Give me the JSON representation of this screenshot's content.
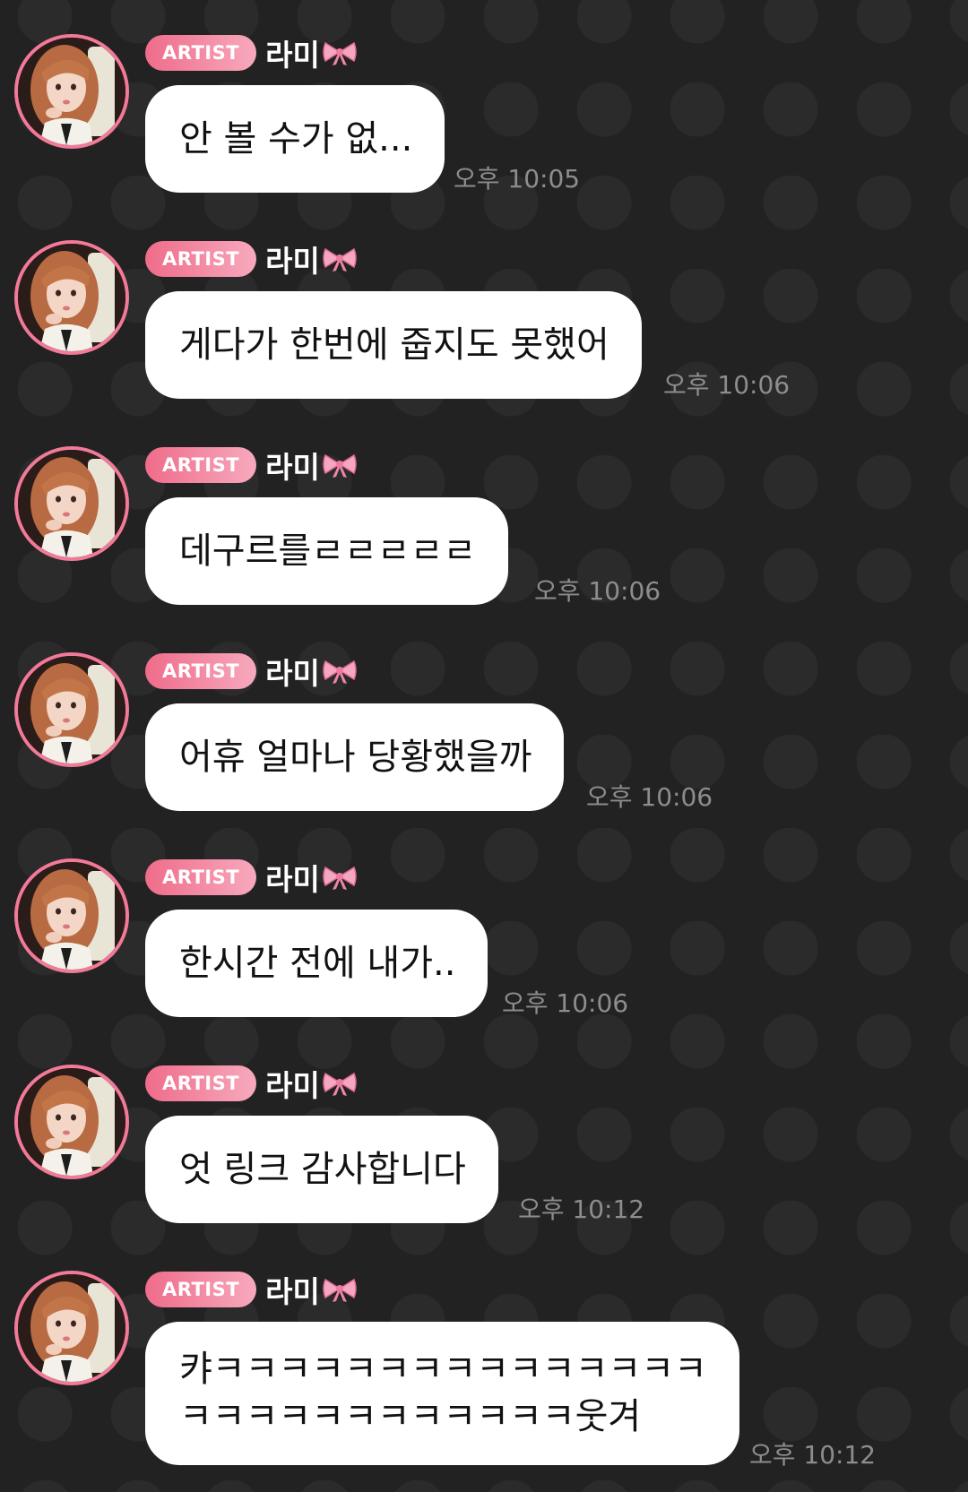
{
  "chat": {
    "messages": [
      {
        "badge": "ARTIST",
        "name": "라미",
        "text": "안 볼 수가 없...",
        "time": "오후 10:05"
      },
      {
        "badge": "ARTIST",
        "name": "라미",
        "text": "게다가 한번에 줍지도 못했어",
        "time": "오후 10:06"
      },
      {
        "badge": "ARTIST",
        "name": "라미",
        "text": "데구르를ㄹㄹㄹㄹㄹ",
        "time": "오후 10:06"
      },
      {
        "badge": "ARTIST",
        "name": "라미",
        "text": "어휴 얼마나 당황했을까",
        "time": "오후 10:06"
      },
      {
        "badge": "ARTIST",
        "name": "라미",
        "text": "한시간 전에 내가..",
        "time": "오후 10:06"
      },
      {
        "badge": "ARTIST",
        "name": "라미",
        "text": "엇 링크 감사합니다",
        "time": "오후 10:12"
      },
      {
        "badge": "ARTIST",
        "name": "라미",
        "text": "캬ㅋㅋㅋㅋㅋㅋㅋㅋㅋㅋㅋㅋㅋㅋㅋ\nㅋㅋㅋㅋㅋㅋㅋㅋㅋㅋㅋㅋ웃겨",
        "time": "오후 10:12"
      }
    ]
  },
  "icons": {
    "name_suffix": "ribbon-bow-icon",
    "avatar": "profile-photo"
  },
  "colors": {
    "background": "#232223",
    "badge_start": "#ef6c8a",
    "badge_end": "#f7a9bd",
    "avatar_ring": "#f27a98",
    "bubble": "#ffffff",
    "timestamp": "#8e8c8d"
  }
}
